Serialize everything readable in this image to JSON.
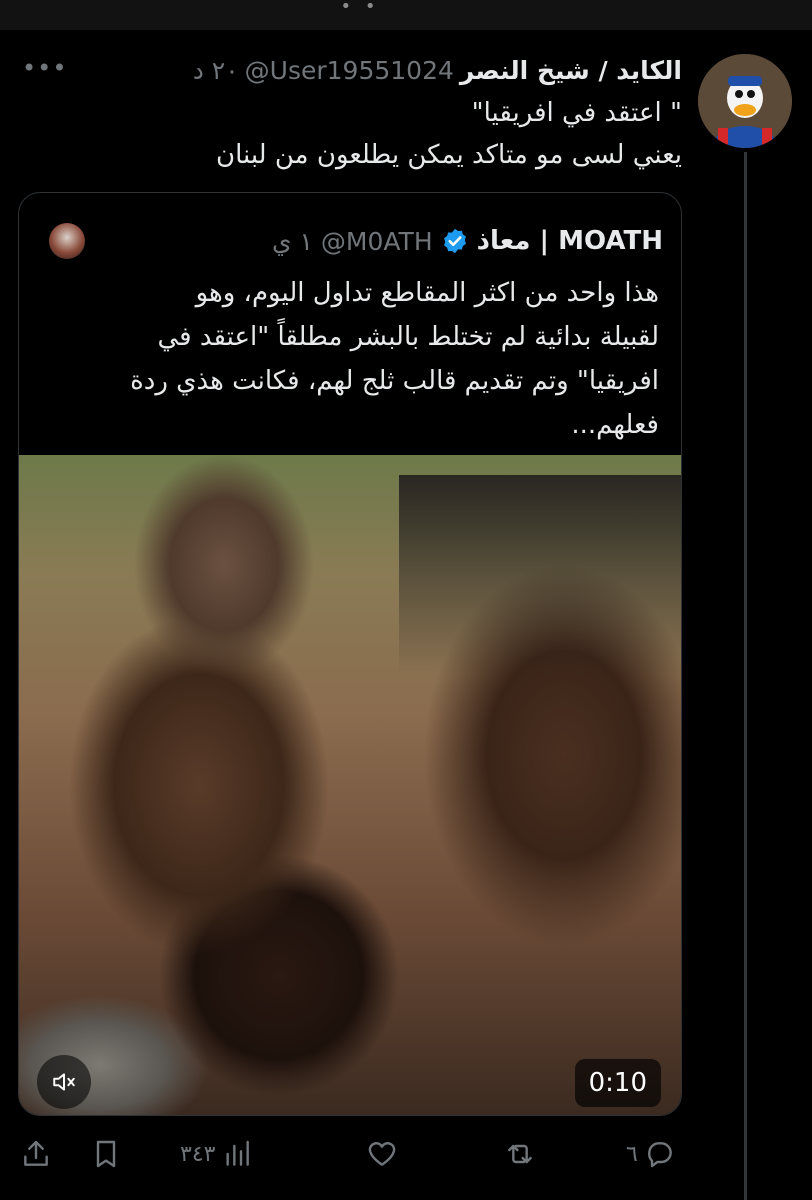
{
  "topbar": {
    "dots": "• •"
  },
  "tweet": {
    "display_name": "الكايد / شيخ النصر",
    "handle": "@User19551024",
    "time": "٢٠ د",
    "text_lines": [
      "\" اعتقد في افريقيا\"",
      "يعني لسى مو متاكد يمكن يطلعون من لبنان"
    ],
    "more_label": "•••"
  },
  "quote": {
    "name": "MOATH | معاذ",
    "handle": "@M0ATH",
    "time": "١ ي",
    "text_lines": [
      "هذا واحد من اكثر المقاطع تداول اليوم، وهو",
      "لقبيلة بدائية لم تختلط بالبشر مطلقاً \"اعتقد في",
      "افريقيا\" وتم تقديم قالب ثلج لهم، فكانت هذي ردة",
      "فعلهم..."
    ],
    "video": {
      "duration": "0:10",
      "muted": true
    }
  },
  "actions": {
    "replies": "٦",
    "views": "٣٤٣"
  },
  "colors": {
    "background": "#000000",
    "text": "#e7e9ea",
    "muted": "#71767b",
    "verified": "#1d9bf0",
    "border": "#2f3336"
  }
}
